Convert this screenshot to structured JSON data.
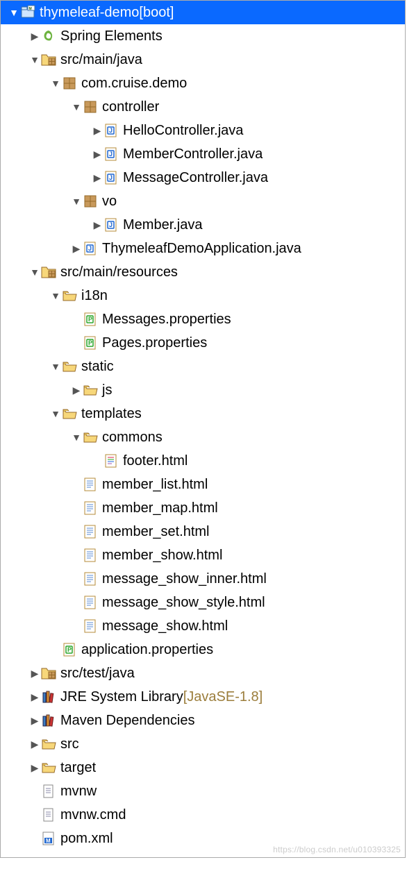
{
  "watermark": "https://blog.csdn.net/u010393325",
  "rows": [
    {
      "depth": 0,
      "arrow": "down",
      "icon": "project",
      "selected": true,
      "label": "thymeleaf-demo",
      "decor": " [boot]"
    },
    {
      "depth": 1,
      "arrow": "right",
      "icon": "spring",
      "label": "Spring Elements"
    },
    {
      "depth": 1,
      "arrow": "down",
      "icon": "src-pkg",
      "label": "src/main/java"
    },
    {
      "depth": 2,
      "arrow": "down",
      "icon": "package",
      "label": "com.cruise.demo"
    },
    {
      "depth": 3,
      "arrow": "down",
      "icon": "package",
      "label": "controller"
    },
    {
      "depth": 4,
      "arrow": "right",
      "icon": "java",
      "label": "HelloController.java"
    },
    {
      "depth": 4,
      "arrow": "right",
      "icon": "java",
      "label": "MemberController.java"
    },
    {
      "depth": 4,
      "arrow": "right",
      "icon": "java",
      "label": "MessageController.java"
    },
    {
      "depth": 3,
      "arrow": "down",
      "icon": "package",
      "label": "vo"
    },
    {
      "depth": 4,
      "arrow": "right",
      "icon": "java",
      "label": "Member.java"
    },
    {
      "depth": 3,
      "arrow": "right",
      "icon": "java",
      "label": "ThymeleafDemoApplication.java"
    },
    {
      "depth": 1,
      "arrow": "down",
      "icon": "src-pkg",
      "label": "src/main/resources"
    },
    {
      "depth": 2,
      "arrow": "down",
      "icon": "folder-open",
      "label": "i18n"
    },
    {
      "depth": 3,
      "arrow": "none",
      "icon": "propsP",
      "label": "Messages.properties"
    },
    {
      "depth": 3,
      "arrow": "none",
      "icon": "propsP",
      "label": "Pages.properties"
    },
    {
      "depth": 2,
      "arrow": "down",
      "icon": "folder-open",
      "label": "static"
    },
    {
      "depth": 3,
      "arrow": "right",
      "icon": "folder-open",
      "label": "js"
    },
    {
      "depth": 2,
      "arrow": "down",
      "icon": "folder-open",
      "label": "templates"
    },
    {
      "depth": 3,
      "arrow": "down",
      "icon": "folder-open",
      "label": "commons"
    },
    {
      "depth": 4,
      "arrow": "none",
      "icon": "html-color",
      "label": "footer.html"
    },
    {
      "depth": 3,
      "arrow": "none",
      "icon": "html",
      "label": "member_list.html"
    },
    {
      "depth": 3,
      "arrow": "none",
      "icon": "html",
      "label": "member_map.html"
    },
    {
      "depth": 3,
      "arrow": "none",
      "icon": "html",
      "label": "member_set.html"
    },
    {
      "depth": 3,
      "arrow": "none",
      "icon": "html",
      "label": "member_show.html"
    },
    {
      "depth": 3,
      "arrow": "none",
      "icon": "html",
      "label": "message_show_inner.html"
    },
    {
      "depth": 3,
      "arrow": "none",
      "icon": "html",
      "label": "message_show_style.html"
    },
    {
      "depth": 3,
      "arrow": "none",
      "icon": "html",
      "label": "message_show.html"
    },
    {
      "depth": 2,
      "arrow": "none",
      "icon": "propsP",
      "label": "application.properties"
    },
    {
      "depth": 1,
      "arrow": "right",
      "icon": "src-pkg",
      "label": "src/test/java"
    },
    {
      "depth": 1,
      "arrow": "right",
      "icon": "library",
      "label": "JRE System Library",
      "decor": " [JavaSE-1.8]"
    },
    {
      "depth": 1,
      "arrow": "right",
      "icon": "library",
      "label": "Maven Dependencies"
    },
    {
      "depth": 1,
      "arrow": "right",
      "icon": "folder-open",
      "label": "src"
    },
    {
      "depth": 1,
      "arrow": "right",
      "icon": "folder-open",
      "label": "target"
    },
    {
      "depth": 2,
      "arrow": "none",
      "icon": "file",
      "label": "mvnw",
      "depthOverride": 1,
      "noarrow": true
    },
    {
      "depth": 2,
      "arrow": "none",
      "icon": "file",
      "label": "mvnw.cmd",
      "depthOverride": 1,
      "noarrow": true
    },
    {
      "depth": 2,
      "arrow": "none",
      "icon": "maven",
      "label": "pom.xml",
      "depthOverride": 1,
      "noarrow": true
    }
  ]
}
